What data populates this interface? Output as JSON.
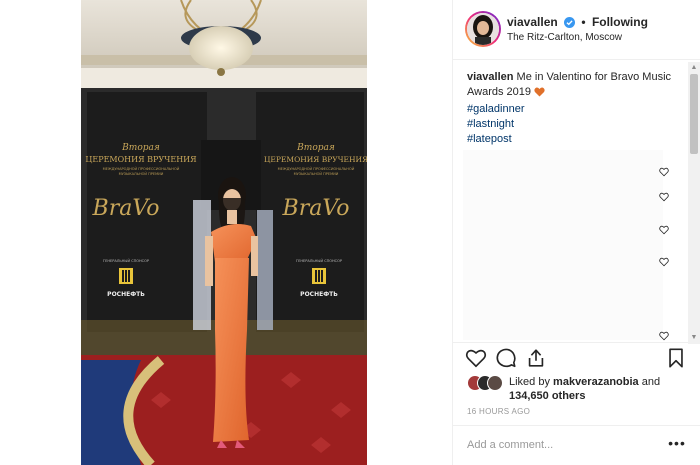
{
  "header": {
    "username": "viavallen",
    "dot": "•",
    "follow_label": "Following",
    "location": "The Ritz-Carlton, Moscow"
  },
  "caption": {
    "username": "viavallen",
    "text": "Me in Valentino for Bravo Music Awards 2019",
    "hashtags": [
      "#galadinner",
      "#lastnight",
      "#latepost"
    ]
  },
  "photo": {
    "banner_line1": "Вторая",
    "banner_line2": "ЦЕРЕМОНИЯ ВРУЧЕНИЯ",
    "banner_line3": "МЕЖДУНАРОДНОЙ ПРОФЕССИОНАЛЬНОЙ",
    "banner_line4": "МУЗЫКАЛЬНОЙ ПРЕМИИ",
    "brand": "BraVo",
    "sponsor": "ГЕНЕРАЛЬНЫЙ СПОНСОР",
    "sponsor_name": "РОСНЕФТЬ"
  },
  "likes": {
    "prefix": "Liked by",
    "first_user": "makverazanobia",
    "joiner": "and",
    "count": "134,650 others"
  },
  "time_ago": "16 HOURS AGO",
  "comment_input": {
    "placeholder": "Add a comment..."
  },
  "more_label": "•••",
  "colors": {
    "link": "#003569",
    "verified": "#3897f0",
    "heart_emoji": "#e0702a",
    "dress": "#f08040"
  },
  "icons": {
    "like": "heart-outline-icon",
    "comment": "comment-bubble-icon",
    "share": "share-arrow-icon",
    "save": "bookmark-icon"
  }
}
